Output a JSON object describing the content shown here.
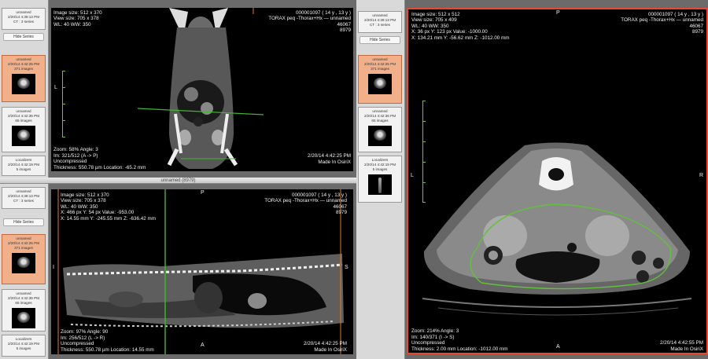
{
  "window": {
    "tl_title": "unnamed (8979)"
  },
  "sidebar_tl": {
    "card1": [
      "unnamed",
      "2/20/14 4:39:13 PM",
      "CT : 3 series"
    ],
    "hide_label": "Hide Series",
    "card2": [
      "unnamed",
      "2/20/14 4:42:25 PM",
      "371 images"
    ],
    "card3": [
      "unnamed",
      "2/20/14 4:42:36 PM",
      "65 images"
    ],
    "card4": [
      "Localizers",
      "2/20/14 4:42:19 PM",
      "5 images"
    ]
  },
  "sidebar_bl": {
    "card1": [
      "unnamed",
      "2/20/14 4:39:13 PM",
      "CT : 3 series"
    ],
    "hide_label": "Hide Series",
    "card2": [
      "unnamed",
      "2/20/14 4:42:25 PM",
      "371 images"
    ],
    "card3": [
      "unnamed",
      "2/20/14 4:42:36 PM",
      "65 images"
    ],
    "card4": [
      "Localizers",
      "2/20/14 4:42:19 PM",
      "5 images"
    ]
  },
  "sidebar_r": {
    "card1": [
      "unnamed",
      "2/20/14 4:39:13 PM",
      "CT : 3 series"
    ],
    "hide_label": "Hide Series",
    "card2": [
      "unnamed",
      "2/20/14 4:42:25 PM",
      "371 images"
    ],
    "card3": [
      "unnamed",
      "2/20/14 4:42:36 PM",
      "65 images"
    ],
    "card4": [
      "Localizers",
      "2/20/14 4:42:19 PM",
      "5 images"
    ]
  },
  "viewer_tl": {
    "tl": [
      "Image size: 512 x 370",
      "View size: 705 x 378",
      "WL: 40 WW: 350"
    ],
    "tr": [
      "000001097 ( 14 y , 13 y )",
      "TORAX peq -Thorax+Hx — unnamed",
      "46067",
      "8979"
    ],
    "bl": [
      "Zoom: 58% Angle: 3",
      "Im: 321/512 (A -> P)",
      "Uncompressed",
      "Thickness: 550.78 µm Location: -65.2 mm"
    ],
    "br": [
      "2/20/14 4:42:25 PM",
      "Made In OsiriX"
    ],
    "left": "L"
  },
  "viewer_bl": {
    "tl": [
      "Image size: 512 x 370",
      "View size: 705 x 378",
      "WL: 40 WW: 350",
      "X: 466 px Y: 54 px Value: -953.00",
      "X: 14.55 mm Y: -245.55 mm Z: -636.42 mm"
    ],
    "tr": [
      "000001097 ( 14 y , 13 y )",
      "TORAX peq -Thorax+Hx — unnamed",
      "46067",
      "8979"
    ],
    "bl": [
      "Zoom: 97% Angle: 90",
      "Im: 256/512 (L -> R)",
      "Uncompressed",
      "Thickness: 550.78 µm Location: 14.55 mm"
    ],
    "br": [
      "2/20/14 4:42:25 PM",
      "Made In OsiriX"
    ],
    "top": "P",
    "left": "I",
    "right": "S",
    "bottom": "A"
  },
  "viewer_r": {
    "tl": [
      "Image size: 512 x 512",
      "View size: 705 x 409",
      "WL: 40 WW: 350",
      "X: 36 px Y: 123 px Value: -1000.00",
      "X: 134.21 mm Y: -56.62 mm Z: -1012.00 mm"
    ],
    "tr": [
      "000001097 ( 14 y , 13 y )",
      "TORAX peq -Thorax+Hx — unnamed",
      "46067",
      "8979"
    ],
    "bl": [
      "Zoom: 214% Angle: 3",
      "Im: 140/371 (I -> S)",
      "Uncompressed",
      "Thickness: 2.00 mm Location: -1012.00 mm"
    ],
    "br": [
      "2/20/14 4:42:55 PM",
      "Made In OsiriX"
    ],
    "top": "P",
    "left": "L",
    "right": "R",
    "bottom": "A"
  }
}
